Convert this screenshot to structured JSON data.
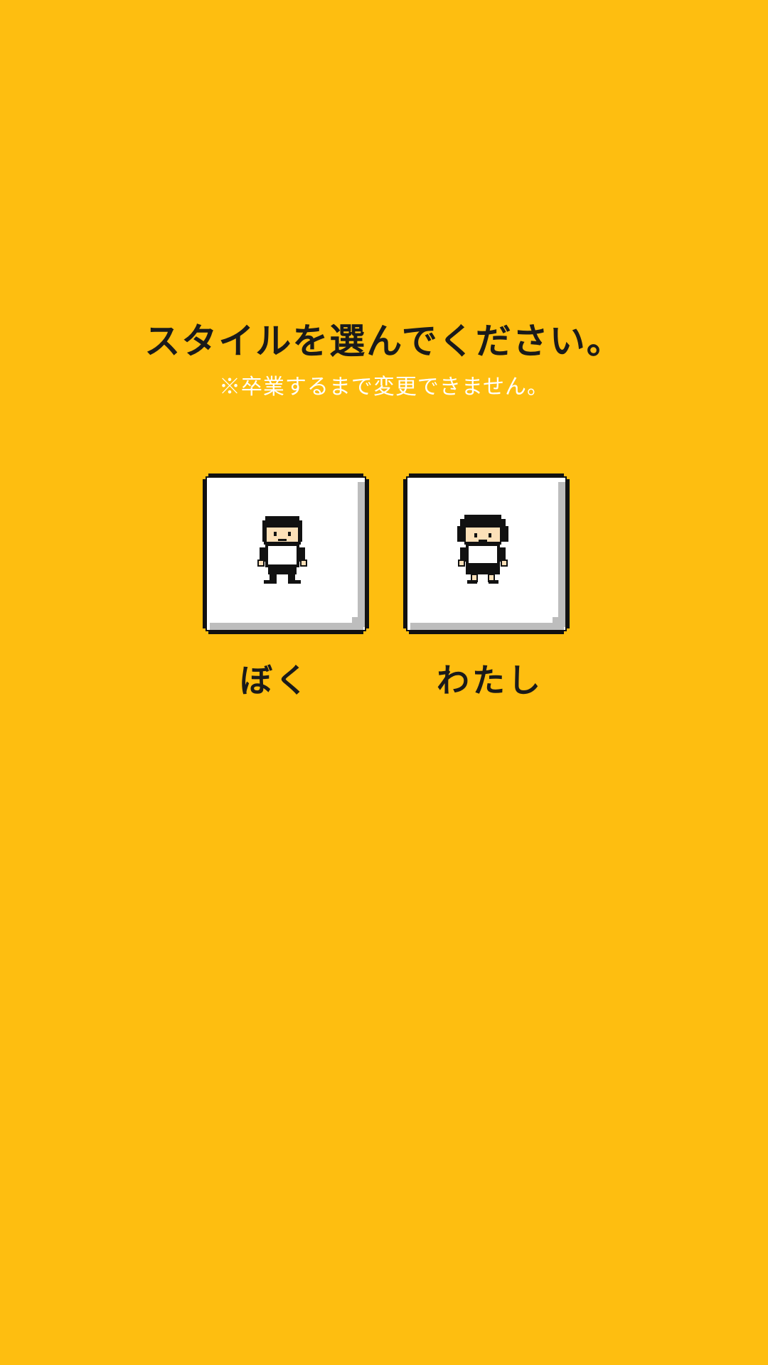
{
  "screen": {
    "background_color": "#FEBE10",
    "title": "スタイルを選んでください。",
    "subtitle": "※卒業するまで変更できません。"
  },
  "options": [
    {
      "id": "boku",
      "label": "ぼく",
      "icon": "boy-character-icon"
    },
    {
      "id": "watashi",
      "label": "わたし",
      "icon": "girl-character-icon"
    }
  ]
}
